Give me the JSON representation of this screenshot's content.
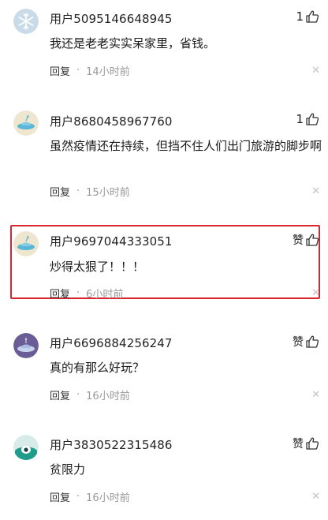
{
  "comments": [
    {
      "username": "用户5095146648945",
      "like_label": "1",
      "content": "我还是老老实实呆家里，省钱。",
      "reply_label": "回复",
      "dot": "·",
      "time": "14小时前",
      "close": "✕",
      "avatar_icon": "snowflake-avatar-icon"
    },
    {
      "username": "用户8680458967760",
      "like_label": "1",
      "content": "虽然疫情还在持续，但挡不住人们出门旅游的脚步啊",
      "reply_label": "回复",
      "dot": "·",
      "time": "15小时前",
      "close": "✕",
      "avatar_icon": "ufo-avatar-icon"
    },
    {
      "username": "用户9697044333051",
      "like_label": "赞",
      "content": "炒得太狠了！！！",
      "reply_label": "回复",
      "dot": "·",
      "time": "6小时前",
      "close": "✕",
      "avatar_icon": "ufo-avatar-icon",
      "highlighted": true
    },
    {
      "username": "用户6696884256247",
      "like_label": "赞",
      "content": "真的有那么好玩？",
      "reply_label": "回复",
      "dot": "·",
      "time": "16小时前",
      "close": "✕",
      "avatar_icon": "ufo-purple-avatar-icon"
    },
    {
      "username": "用户3830522315486",
      "like_label": "赞",
      "content": "贫限力",
      "reply_label": "回复",
      "dot": "·",
      "time": "16小时前",
      "close": "✕",
      "avatar_icon": "ufo-teal-avatar-icon"
    }
  ],
  "colors": {
    "highlight_border": "#d8252f",
    "muted_text": "#999999",
    "close_icon": "#c4c4c4"
  }
}
